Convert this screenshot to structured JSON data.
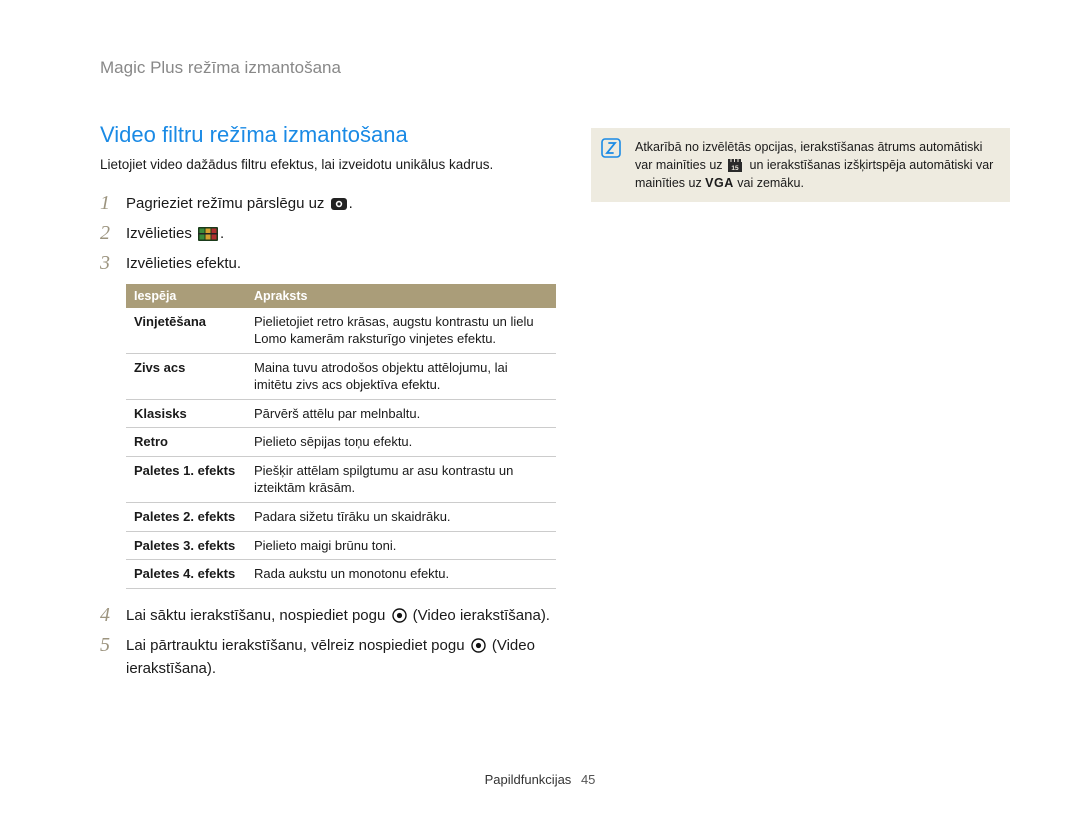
{
  "breadcrumb": "Magic Plus režīma izmantošana",
  "title": "Video filtru režīma izmantošana",
  "intro": "Lietojiet video dažādus filtru efektus, lai izveidotu unikālus kadrus.",
  "steps": {
    "s1": "Pagrieziet režīmu pārslēgu uz ",
    "s1b": ".",
    "s2": "Izvēlieties ",
    "s2b": ".",
    "s3": "Izvēlieties efektu.",
    "s4a": "Lai sāktu ierakstīšanu, nospiediet pogu ",
    "s4b": " (Video ierakstīšana).",
    "s5a": "Lai pārtrauktu ierakstīšanu, vēlreiz nospiediet pogu ",
    "s5b": " (Video ierakstīšana)."
  },
  "table": {
    "h1": "Iespēja",
    "h2": "Apraksts",
    "rows": [
      {
        "o": "Vinjetēšana",
        "d": "Pielietojiet retro krāsas, augstu kontrastu un lielu Lomo kamerām raksturīgo vinjetes efektu."
      },
      {
        "o": "Zivs acs",
        "d": "Maina tuvu atrodošos objektu attēlojumu, lai imitētu zivs acs objektīva efektu."
      },
      {
        "o": "Klasisks",
        "d": "Pārvērš attēlu par melnbaltu."
      },
      {
        "o": "Retro",
        "d": "Pielieto sēpijas toņu efektu."
      },
      {
        "o": "Paletes 1. efekts",
        "d": "Piešķir attēlam spilgtumu ar asu kontrastu un izteiktām krāsām."
      },
      {
        "o": "Paletes 2. efekts",
        "d": "Padara sižetu tīrāku un skaidrāku."
      },
      {
        "o": "Paletes 3. efekts",
        "d": "Pielieto maigi brūnu toni."
      },
      {
        "o": "Paletes 4. efekts",
        "d": "Rada aukstu un monotonu efektu."
      }
    ]
  },
  "note": {
    "p1": "Atkarībā no izvēlētās opcijas, ierakstīšanas ātrums automātiski var mainīties uz ",
    "p2": " un ierakstīšanas izšķirtspēja automātiski var mainīties uz ",
    "vga": "VGA",
    "p3": " vai zemāku."
  },
  "footer": {
    "label": "Papildfunkcijas",
    "page": "45"
  }
}
